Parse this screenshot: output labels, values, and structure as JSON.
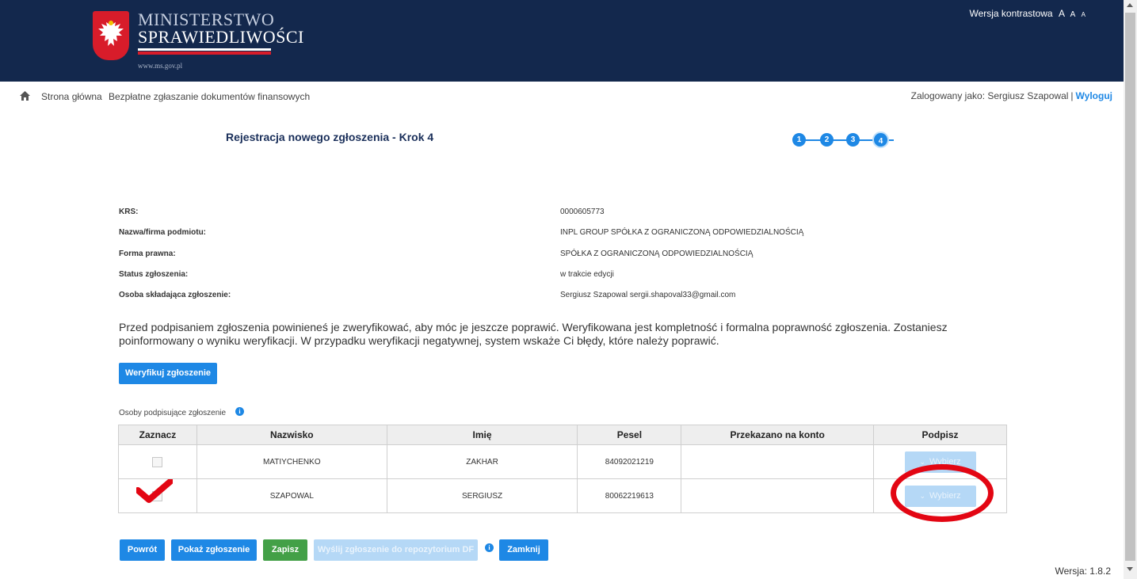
{
  "header": {
    "logo_line1": "MINISTERSTWO",
    "logo_line2": "SPRAWIEDLIWOŚCI",
    "logo_url": "www.ms.gov.pl",
    "contrast_label": "Wersja kontrastowa",
    "font_sizes": [
      "A",
      "A",
      "A"
    ]
  },
  "breadcrumb": {
    "home_icon": "home-icon",
    "items": [
      "Strona główna",
      "Bezpłatne zgłaszanie dokumentów finansowych"
    ]
  },
  "user": {
    "logged_as": "Zalogowany jako: Sergiusz Szapowal",
    "separator": "|",
    "logout": "Wyloguj"
  },
  "page_title": "Rejestracja nowego zgłoszenia - Krok 4",
  "steps": {
    "labels": [
      "1",
      "2",
      "3",
      "4"
    ],
    "current": 4
  },
  "info": {
    "krs_label": "KRS:",
    "krs_value": "0000605773",
    "name_label": "Nazwa/firma podmiotu:",
    "name_value": "INPL GROUP SPÓŁKA Z OGRANICZONĄ ODPOWIEDZIALNOŚCIĄ",
    "form_label": "Forma prawna:",
    "form_value": "SPÓŁKA Z OGRANICZONĄ ODPOWIEDZIALNOŚCIĄ",
    "status_label": "Status zgłoszenia:",
    "status_value": "w trakcie edycji",
    "person_label": "Osoba składająca zgłoszenie:",
    "person_value": "Sergiusz Szapowal sergii.shapoval33@gmail.com"
  },
  "notice": "Przed podpisaniem zgłoszenia powinieneś je zweryfikować, aby móc je jeszcze poprawić. Weryfikowana jest kompletność i formalna poprawność zgłoszenia. Zostaniesz poinformowany o wyniku weryfikacji. W przypadku weryfikacji negatywnej, system wskaże Ci błędy, które należy poprawić.",
  "verify_button": "Weryfikuj zgłoszenie",
  "signers": {
    "section_label": "Osoby podpisujące zgłoszenie",
    "info_glyph": "i",
    "columns": [
      "Zaznacz",
      "Nazwisko",
      "Imię",
      "Pesel",
      "Przekazano na konto",
      "Podpisz"
    ],
    "rows": [
      {
        "surname": "MATIYCHENKO",
        "name": "ZAKHAR",
        "pesel": "84092021219",
        "transferred": "",
        "sign": "Wybierz",
        "checked": false
      },
      {
        "surname": "SZAPOWAL",
        "name": "SERGIUSZ",
        "pesel": "80062219613",
        "transferred": "",
        "sign": "Wybierz",
        "checked": false
      }
    ],
    "chevron": "⌄"
  },
  "actions": {
    "back": "Powrót",
    "show": "Pokaż zgłoszenie",
    "save": "Zapisz",
    "send": "Wyślij zgłoszenie do repozytorium DF",
    "close": "Zamknij"
  },
  "version": "Wersja: 1.8.2",
  "colors": {
    "header_bg": "#13284d",
    "primary": "#1e88e5",
    "success": "#43a047",
    "disabled": "#b5d8f6",
    "annotation": "#e30613"
  }
}
